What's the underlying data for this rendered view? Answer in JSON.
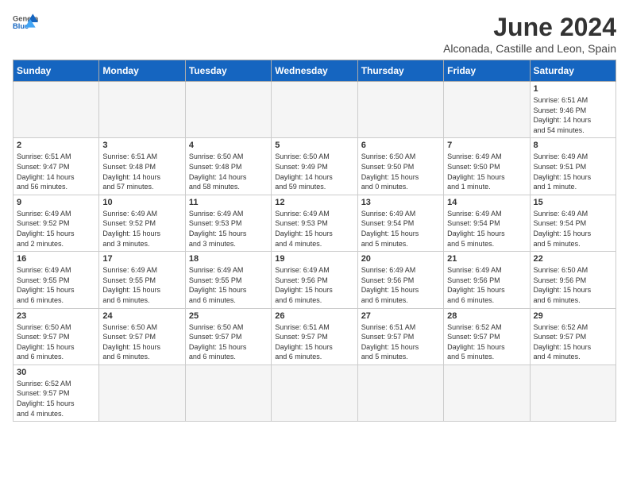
{
  "header": {
    "logo_general": "General",
    "logo_blue": "Blue",
    "month_title": "June 2024",
    "location": "Alconada, Castille and Leon, Spain"
  },
  "weekdays": [
    "Sunday",
    "Monday",
    "Tuesday",
    "Wednesday",
    "Thursday",
    "Friday",
    "Saturday"
  ],
  "weeks": [
    [
      {
        "day": "",
        "info": ""
      },
      {
        "day": "",
        "info": ""
      },
      {
        "day": "",
        "info": ""
      },
      {
        "day": "",
        "info": ""
      },
      {
        "day": "",
        "info": ""
      },
      {
        "day": "",
        "info": ""
      },
      {
        "day": "1",
        "info": "Sunrise: 6:51 AM\nSunset: 9:46 PM\nDaylight: 14 hours\nand 54 minutes."
      }
    ],
    [
      {
        "day": "2",
        "info": "Sunrise: 6:51 AM\nSunset: 9:47 PM\nDaylight: 14 hours\nand 56 minutes."
      },
      {
        "day": "3",
        "info": "Sunrise: 6:51 AM\nSunset: 9:48 PM\nDaylight: 14 hours\nand 57 minutes."
      },
      {
        "day": "4",
        "info": "Sunrise: 6:50 AM\nSunset: 9:48 PM\nDaylight: 14 hours\nand 58 minutes."
      },
      {
        "day": "5",
        "info": "Sunrise: 6:50 AM\nSunset: 9:49 PM\nDaylight: 14 hours\nand 59 minutes."
      },
      {
        "day": "6",
        "info": "Sunrise: 6:50 AM\nSunset: 9:50 PM\nDaylight: 15 hours\nand 0 minutes."
      },
      {
        "day": "7",
        "info": "Sunrise: 6:49 AM\nSunset: 9:50 PM\nDaylight: 15 hours\nand 1 minute."
      },
      {
        "day": "8",
        "info": "Sunrise: 6:49 AM\nSunset: 9:51 PM\nDaylight: 15 hours\nand 1 minute."
      }
    ],
    [
      {
        "day": "9",
        "info": "Sunrise: 6:49 AM\nSunset: 9:52 PM\nDaylight: 15 hours\nand 2 minutes."
      },
      {
        "day": "10",
        "info": "Sunrise: 6:49 AM\nSunset: 9:52 PM\nDaylight: 15 hours\nand 3 minutes."
      },
      {
        "day": "11",
        "info": "Sunrise: 6:49 AM\nSunset: 9:53 PM\nDaylight: 15 hours\nand 3 minutes."
      },
      {
        "day": "12",
        "info": "Sunrise: 6:49 AM\nSunset: 9:53 PM\nDaylight: 15 hours\nand 4 minutes."
      },
      {
        "day": "13",
        "info": "Sunrise: 6:49 AM\nSunset: 9:54 PM\nDaylight: 15 hours\nand 5 minutes."
      },
      {
        "day": "14",
        "info": "Sunrise: 6:49 AM\nSunset: 9:54 PM\nDaylight: 15 hours\nand 5 minutes."
      },
      {
        "day": "15",
        "info": "Sunrise: 6:49 AM\nSunset: 9:54 PM\nDaylight: 15 hours\nand 5 minutes."
      }
    ],
    [
      {
        "day": "16",
        "info": "Sunrise: 6:49 AM\nSunset: 9:55 PM\nDaylight: 15 hours\nand 6 minutes."
      },
      {
        "day": "17",
        "info": "Sunrise: 6:49 AM\nSunset: 9:55 PM\nDaylight: 15 hours\nand 6 minutes."
      },
      {
        "day": "18",
        "info": "Sunrise: 6:49 AM\nSunset: 9:55 PM\nDaylight: 15 hours\nand 6 minutes."
      },
      {
        "day": "19",
        "info": "Sunrise: 6:49 AM\nSunset: 9:56 PM\nDaylight: 15 hours\nand 6 minutes."
      },
      {
        "day": "20",
        "info": "Sunrise: 6:49 AM\nSunset: 9:56 PM\nDaylight: 15 hours\nand 6 minutes."
      },
      {
        "day": "21",
        "info": "Sunrise: 6:49 AM\nSunset: 9:56 PM\nDaylight: 15 hours\nand 6 minutes."
      },
      {
        "day": "22",
        "info": "Sunrise: 6:50 AM\nSunset: 9:56 PM\nDaylight: 15 hours\nand 6 minutes."
      }
    ],
    [
      {
        "day": "23",
        "info": "Sunrise: 6:50 AM\nSunset: 9:57 PM\nDaylight: 15 hours\nand 6 minutes."
      },
      {
        "day": "24",
        "info": "Sunrise: 6:50 AM\nSunset: 9:57 PM\nDaylight: 15 hours\nand 6 minutes."
      },
      {
        "day": "25",
        "info": "Sunrise: 6:50 AM\nSunset: 9:57 PM\nDaylight: 15 hours\nand 6 minutes."
      },
      {
        "day": "26",
        "info": "Sunrise: 6:51 AM\nSunset: 9:57 PM\nDaylight: 15 hours\nand 6 minutes."
      },
      {
        "day": "27",
        "info": "Sunrise: 6:51 AM\nSunset: 9:57 PM\nDaylight: 15 hours\nand 5 minutes."
      },
      {
        "day": "28",
        "info": "Sunrise: 6:52 AM\nSunset: 9:57 PM\nDaylight: 15 hours\nand 5 minutes."
      },
      {
        "day": "29",
        "info": "Sunrise: 6:52 AM\nSunset: 9:57 PM\nDaylight: 15 hours\nand 4 minutes."
      }
    ],
    [
      {
        "day": "30",
        "info": "Sunrise: 6:52 AM\nSunset: 9:57 PM\nDaylight: 15 hours\nand 4 minutes."
      },
      {
        "day": "",
        "info": ""
      },
      {
        "day": "",
        "info": ""
      },
      {
        "day": "",
        "info": ""
      },
      {
        "day": "",
        "info": ""
      },
      {
        "day": "",
        "info": ""
      },
      {
        "day": "",
        "info": ""
      }
    ]
  ]
}
